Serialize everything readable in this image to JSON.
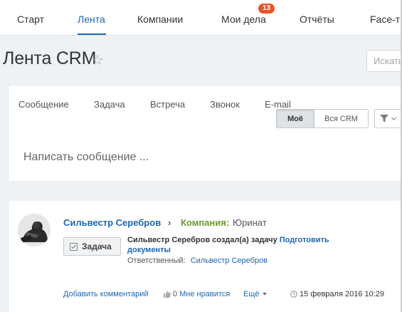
{
  "nav": {
    "items": [
      "Старт",
      "Лента",
      "Компании",
      "Мои дела",
      "Отчёты",
      "Face-тр"
    ],
    "active": 1,
    "badge": "13"
  },
  "page": {
    "title": "Лента CRM",
    "search_placeholder": "Искать"
  },
  "composer": {
    "tabs": [
      "Сообщение",
      "Задача",
      "Встреча",
      "Звонок",
      "E-mail"
    ],
    "scope_mine": "Моё",
    "scope_all": "Вся CRM",
    "placeholder": "Написать сообщение ..."
  },
  "entry": {
    "author": "Сильвестр Серебров",
    "arrow": "›",
    "company_label": "Компания:",
    "company_value": "Юринат",
    "type_label": "Задача",
    "text_prefix": "Сильвестр Серебров создал(а) задачу",
    "task_link": "Подготовить документы",
    "responsible_label": "Ответственный:",
    "responsible_name": "Сильвестр Серебров",
    "add_comment": "Добавить комментарий",
    "likes_count": "0",
    "like_label": "Мне нравится",
    "more_label": "Ещё",
    "date": "15 февраля 2016 10:29"
  },
  "colors": {
    "accent": "#2067b0",
    "badge": "#e8542a",
    "company": "#6a9b2c"
  }
}
